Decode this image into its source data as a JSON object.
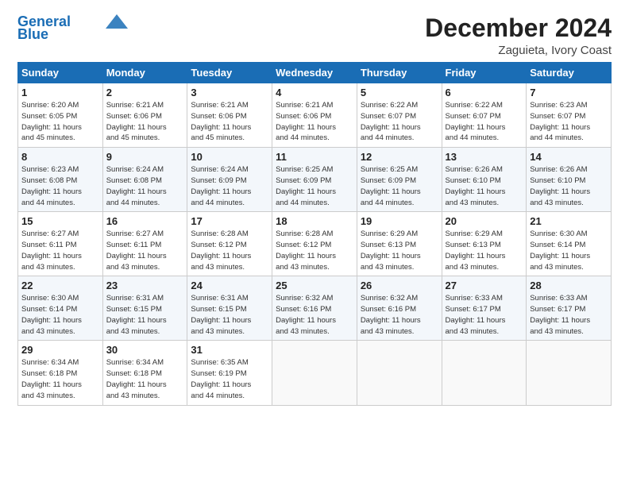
{
  "logo": {
    "line1": "General",
    "line2": "Blue"
  },
  "header": {
    "month": "December 2024",
    "location": "Zaguieta, Ivory Coast"
  },
  "days_of_week": [
    "Sunday",
    "Monday",
    "Tuesday",
    "Wednesday",
    "Thursday",
    "Friday",
    "Saturday"
  ],
  "weeks": [
    [
      {
        "day": "1",
        "detail": "Sunrise: 6:20 AM\nSunset: 6:05 PM\nDaylight: 11 hours\nand 45 minutes."
      },
      {
        "day": "2",
        "detail": "Sunrise: 6:21 AM\nSunset: 6:06 PM\nDaylight: 11 hours\nand 45 minutes."
      },
      {
        "day": "3",
        "detail": "Sunrise: 6:21 AM\nSunset: 6:06 PM\nDaylight: 11 hours\nand 45 minutes."
      },
      {
        "day": "4",
        "detail": "Sunrise: 6:21 AM\nSunset: 6:06 PM\nDaylight: 11 hours\nand 44 minutes."
      },
      {
        "day": "5",
        "detail": "Sunrise: 6:22 AM\nSunset: 6:07 PM\nDaylight: 11 hours\nand 44 minutes."
      },
      {
        "day": "6",
        "detail": "Sunrise: 6:22 AM\nSunset: 6:07 PM\nDaylight: 11 hours\nand 44 minutes."
      },
      {
        "day": "7",
        "detail": "Sunrise: 6:23 AM\nSunset: 6:07 PM\nDaylight: 11 hours\nand 44 minutes."
      }
    ],
    [
      {
        "day": "8",
        "detail": "Sunrise: 6:23 AM\nSunset: 6:08 PM\nDaylight: 11 hours\nand 44 minutes."
      },
      {
        "day": "9",
        "detail": "Sunrise: 6:24 AM\nSunset: 6:08 PM\nDaylight: 11 hours\nand 44 minutes."
      },
      {
        "day": "10",
        "detail": "Sunrise: 6:24 AM\nSunset: 6:09 PM\nDaylight: 11 hours\nand 44 minutes."
      },
      {
        "day": "11",
        "detail": "Sunrise: 6:25 AM\nSunset: 6:09 PM\nDaylight: 11 hours\nand 44 minutes."
      },
      {
        "day": "12",
        "detail": "Sunrise: 6:25 AM\nSunset: 6:09 PM\nDaylight: 11 hours\nand 44 minutes."
      },
      {
        "day": "13",
        "detail": "Sunrise: 6:26 AM\nSunset: 6:10 PM\nDaylight: 11 hours\nand 43 minutes."
      },
      {
        "day": "14",
        "detail": "Sunrise: 6:26 AM\nSunset: 6:10 PM\nDaylight: 11 hours\nand 43 minutes."
      }
    ],
    [
      {
        "day": "15",
        "detail": "Sunrise: 6:27 AM\nSunset: 6:11 PM\nDaylight: 11 hours\nand 43 minutes."
      },
      {
        "day": "16",
        "detail": "Sunrise: 6:27 AM\nSunset: 6:11 PM\nDaylight: 11 hours\nand 43 minutes."
      },
      {
        "day": "17",
        "detail": "Sunrise: 6:28 AM\nSunset: 6:12 PM\nDaylight: 11 hours\nand 43 minutes."
      },
      {
        "day": "18",
        "detail": "Sunrise: 6:28 AM\nSunset: 6:12 PM\nDaylight: 11 hours\nand 43 minutes."
      },
      {
        "day": "19",
        "detail": "Sunrise: 6:29 AM\nSunset: 6:13 PM\nDaylight: 11 hours\nand 43 minutes."
      },
      {
        "day": "20",
        "detail": "Sunrise: 6:29 AM\nSunset: 6:13 PM\nDaylight: 11 hours\nand 43 minutes."
      },
      {
        "day": "21",
        "detail": "Sunrise: 6:30 AM\nSunset: 6:14 PM\nDaylight: 11 hours\nand 43 minutes."
      }
    ],
    [
      {
        "day": "22",
        "detail": "Sunrise: 6:30 AM\nSunset: 6:14 PM\nDaylight: 11 hours\nand 43 minutes."
      },
      {
        "day": "23",
        "detail": "Sunrise: 6:31 AM\nSunset: 6:15 PM\nDaylight: 11 hours\nand 43 minutes."
      },
      {
        "day": "24",
        "detail": "Sunrise: 6:31 AM\nSunset: 6:15 PM\nDaylight: 11 hours\nand 43 minutes."
      },
      {
        "day": "25",
        "detail": "Sunrise: 6:32 AM\nSunset: 6:16 PM\nDaylight: 11 hours\nand 43 minutes."
      },
      {
        "day": "26",
        "detail": "Sunrise: 6:32 AM\nSunset: 6:16 PM\nDaylight: 11 hours\nand 43 minutes."
      },
      {
        "day": "27",
        "detail": "Sunrise: 6:33 AM\nSunset: 6:17 PM\nDaylight: 11 hours\nand 43 minutes."
      },
      {
        "day": "28",
        "detail": "Sunrise: 6:33 AM\nSunset: 6:17 PM\nDaylight: 11 hours\nand 43 minutes."
      }
    ],
    [
      {
        "day": "29",
        "detail": "Sunrise: 6:34 AM\nSunset: 6:18 PM\nDaylight: 11 hours\nand 43 minutes."
      },
      {
        "day": "30",
        "detail": "Sunrise: 6:34 AM\nSunset: 6:18 PM\nDaylight: 11 hours\nand 43 minutes."
      },
      {
        "day": "31",
        "detail": "Sunrise: 6:35 AM\nSunset: 6:19 PM\nDaylight: 11 hours\nand 44 minutes."
      },
      null,
      null,
      null,
      null
    ]
  ]
}
